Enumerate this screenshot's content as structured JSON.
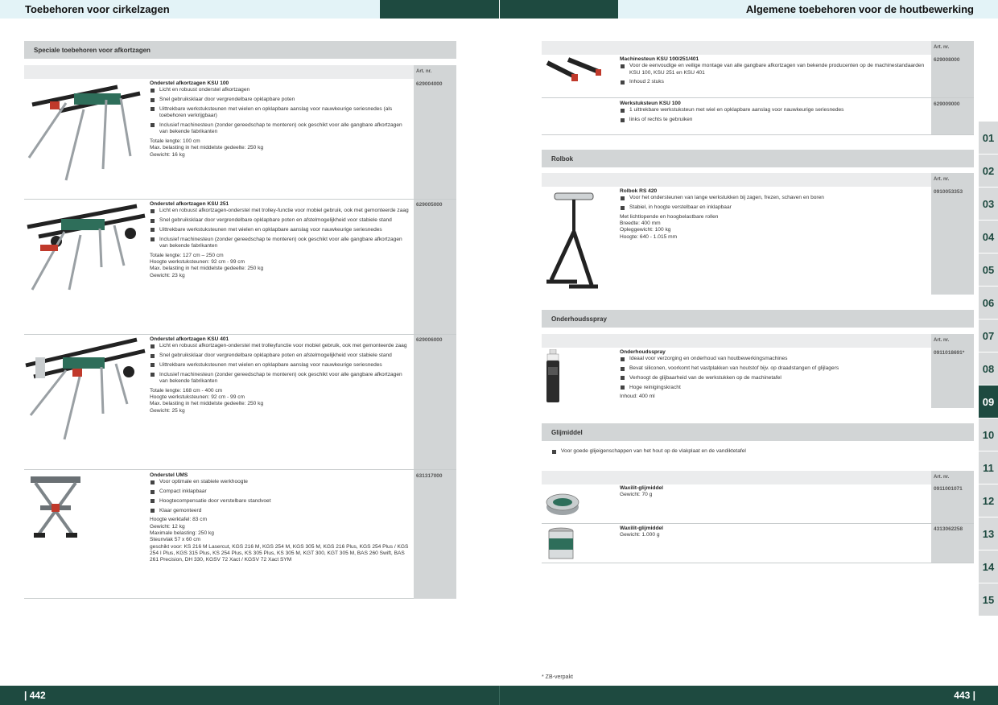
{
  "header": {
    "left_title": "Toebehoren voor cirkelzagen",
    "right_title": "Algemene toebehoren voor de houtbewerking"
  },
  "footer": {
    "left_page": "| 442",
    "right_page": "443 |"
  },
  "colors": {
    "brand_dark": "#1e4a40",
    "header_light": "#e3f3f7",
    "bar_grey": "#d2d5d6"
  },
  "art_nr_label": "Art. nr.",
  "left": {
    "section_title": "Speciale toebehoren voor afkortzagen",
    "products": [
      {
        "name": "Onderstel afkortzagen KSU 100",
        "art": "629004000",
        "bullets": [
          "Licht en robuust onderstel afkortzagen",
          "Snel gebruiksklaar door vergrendelbare opklapbare poten",
          "Uittrekbare werkstuksteunen met wielen en opklapbare aanslag voor nauwkeurige seriesnedes (als toebehoren verkrijgbaar)",
          "Inclusief machinesteun (zonder gereedschap te monteren) ook geschikt voor alle gangbare afkortzagen van bekende fabrikanten"
        ],
        "spec": "Totale lengte: 100 cm\nMax. belasting in het middelste gedeelte: 250 kg\nGewicht: 16 kg",
        "image": "miter-saw-stand-icon"
      },
      {
        "name": "Onderstel afkortzagen KSU 251",
        "art": "629005000",
        "bullets": [
          "Licht en robuust afkortzagen-onderstel met trolley-functie voor mobiel gebruik, ook met gemonteerde zaag",
          "Snel gebruiksklaar door vergrendelbare opklapbare poten en afstelmogelijkheid voor stabiele stand",
          "Uittrekbare werkstuksteunen met wielen en opklapbare aanslag voor nauwkeurige seriesnedes",
          "Inclusief machinesteun (zonder gereedschap te monteren) ook geschikt voor alle gangbare afkortzagen van bekende fabrikanten"
        ],
        "spec": "Totale lengte: 127 cm – 250 cm\nHoogte werkstuksteunen: 92 cm - 99 cm\nMax. belasting in het middelste gedeelte: 250 kg\nGewicht: 23 kg",
        "image": "trolley-saw-stand-icon"
      },
      {
        "name": "Onderstel afkortzagen KSU 401",
        "art": "629006000",
        "bullets": [
          "Licht en robuust afkortzagen-onderstel met trolleyfunctie voor mobiel gebruik, ook met gemonteerde zaag",
          "Snel gebruiksklaar door vergrendelbare opklapbare poten en afstelmogelijkheid voor stabiele stand",
          "Uittrekbare werkstuksteunen met wielen en opklapbare aanslag voor nauwkeurige seriesnedes",
          "Inclusief machinesteun (zonder gereedschap te monteren) ook geschikt voor alle gangbare afkortzagen van bekende fabrikanten"
        ],
        "spec": "Totale lengte: 168 cm - 400 cm\nHoogte werkstuksteunen: 92 cm - 99 cm\nMax. belasting in het middelste gedeelte: 250 kg\nGewicht: 25 kg",
        "image": "extended-saw-stand-icon"
      },
      {
        "name": "Onderstel UMS",
        "art": "631317000",
        "bullets": [
          "Voor optimale en stabiele werkhoogte",
          "Compact inklapbaar",
          "Hoogtecompensatie door verstelbare standvoet",
          "Klaar gemonteerd"
        ],
        "spec": "Hoogte werktafel: 83 cm\nGewicht: 12 kg\nMaximale belasting: 250 kg\nSteunvlak 57 x 60 cm\ngeschikt voor: KS 216 M Lasercut, KGS 216 M, KGS 254 M, KGS 305 M, KGS 216 Plus, KGS 254 Plus / KGS 254 I Plus, KGS 315 Plus, KS 254 Plus, KS 305 Plus, KS 305 M, KGT 300, KGT 305 M, BAS 260 Swift, BAS 261 Precision, DH 330, KGSV 72 Xact / KGSV 72 Xact SYM",
        "image": "universal-stand-icon"
      }
    ]
  },
  "right": {
    "products_top": [
      {
        "name": "Machinesteun KSU 100/251/401",
        "art": "629008000",
        "bullets": [
          "Voor de eenvoudige en veilige montage van alle gangbare afkortzagen van bekende producenten op de machinestandaarden KSU 100, KSU 251 en KSU 401",
          "Inhoud 2 stuks"
        ],
        "image": "machine-support-icon"
      },
      {
        "name": "Werkstuksteun KSU 100",
        "art": "629009000",
        "bullets": [
          "1 uittrekbare werkstuksteun met wiel en opklapbare aanslag voor nauwkeurige seriesnedes",
          "links of rechts te gebruiken"
        ]
      }
    ],
    "rolbok": {
      "title": "Rolbok",
      "name": "Rolbok RS 420",
      "art": "0910053353",
      "bullets": [
        "Voor het ondersteunen van lange werkstukken bij zagen, frezen, schaven en boren",
        "Stabiel, in hoogte verstelbaar en inklapbaar"
      ],
      "spec": "Met lichtlopende en hoogbelastbare rollen\nBreedte: 400 mm\nOpleggewicht: 100 kg\nHoogte: 640 - 1.015 mm",
      "image": "roller-stand-icon"
    },
    "spray": {
      "title": "Onderhoudsspray",
      "name": "Onderhoudsspray",
      "art": "0911018691*",
      "bullets": [
        "Ideaal voor verzorging en onderhoud van houtbewerkingsmachines",
        "Bevat siliconen, voorkomt het vastplakken van houtstof bijv. op draadstangen of glijlagers",
        "Verhoogt de glijbaarheid van de werkstukken op de machinetafel",
        "Hoge reinigingskracht"
      ],
      "spec": "Inhoud: 400 ml",
      "image": "spray-can-icon"
    },
    "glijmiddel": {
      "title": "Glijmiddel",
      "intro": "Voor goede glijeigenschappen van het hout op de vlakplaat en de vandiktetafel",
      "products": [
        {
          "name": "Waxilit-glijmiddel",
          "spec": "Gewicht: 70 g",
          "art": "0911001071",
          "image": "wax-tin-icon"
        },
        {
          "name": "Waxilit-glijmiddel",
          "spec": "Gewicht: 1.000 g",
          "art": "4313062258",
          "image": "wax-can-icon"
        }
      ]
    },
    "footnote": "* ZB-verpakt"
  },
  "tabs": [
    "01",
    "02",
    "03",
    "04",
    "05",
    "06",
    "07",
    "08",
    "09",
    "10",
    "11",
    "12",
    "13",
    "14",
    "15"
  ],
  "active_tab": "09"
}
